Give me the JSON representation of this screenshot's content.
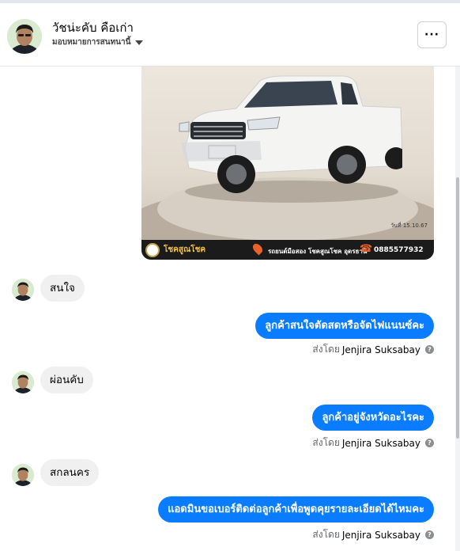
{
  "header": {
    "contact_name": "วัชน่ะคับ คือเก่า",
    "assign_label": "มอบหมายการสนทนานี้",
    "more_label": "···"
  },
  "product_card": {
    "brand": "โชคสูณโชค",
    "address": "รถยนต์มือสอง โชคสูณโชค อุดรธานี",
    "phone": "0885577932",
    "date_note": "วันที่ 15.10.67"
  },
  "messages": [
    {
      "direction": "in",
      "text": "สนใจ"
    },
    {
      "direction": "out",
      "text": "ลูกค้าสนใจตัดสดหรือจัดไฟแนนซ์คะ",
      "sent_by_label": "ส่งโดย",
      "sent_by_name": "Jenjira Suksabay"
    },
    {
      "direction": "in",
      "text": "ผ่อนคับ"
    },
    {
      "direction": "out",
      "text": "ลูกค้าอยู่จังหวัดอะไรคะ",
      "sent_by_label": "ส่งโดย",
      "sent_by_name": "Jenjira Suksabay"
    },
    {
      "direction": "in",
      "text": "สกลนคร"
    },
    {
      "direction": "out",
      "text": "แอดมินขอเบอร์ติดต่อลูกค้าเพื่อพูดคุยรายละเอียดได้ไหมคะ",
      "sent_by_label": "ส่งโดย",
      "sent_by_name": "Jenjira Suksabay"
    }
  ],
  "colors": {
    "outgoing_bubble": "#0a7cff",
    "incoming_bubble": "#f0f0f0",
    "muted_text": "#65676b"
  },
  "icons": {
    "more": "ellipsis-icon",
    "dropdown": "caret-down-icon",
    "help": "question-circle-icon"
  }
}
